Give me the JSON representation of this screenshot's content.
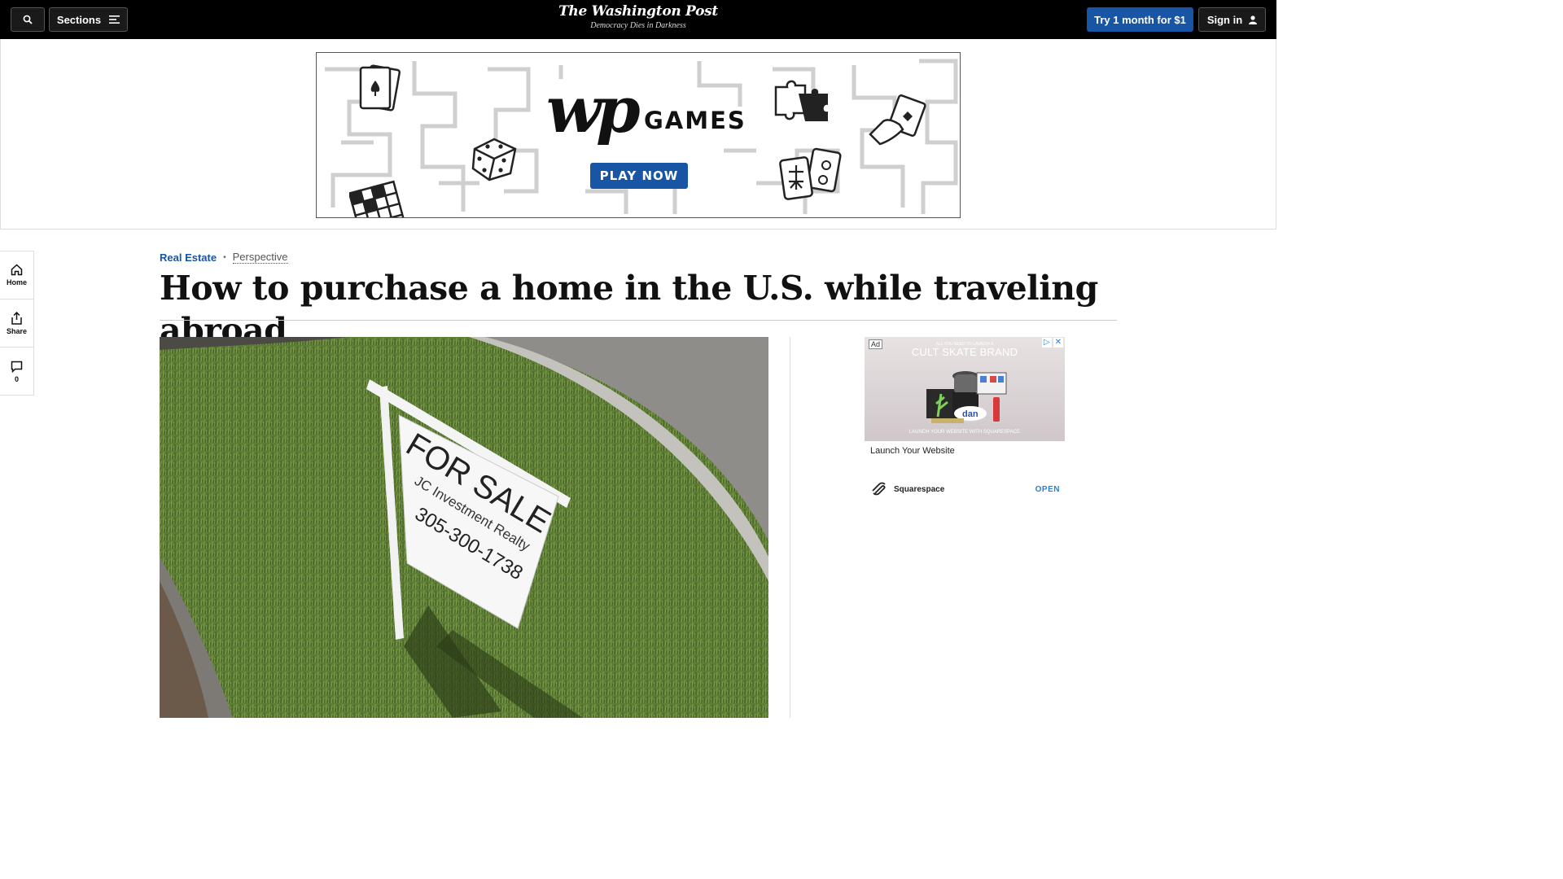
{
  "nav": {
    "sections_label": "Sections",
    "logo_name": "The Washington Post",
    "tagline": "Democracy Dies in Darkness",
    "subscribe_label": "Try 1 month for $1",
    "signin_label": "Sign in"
  },
  "games_ad": {
    "brand": "wp",
    "title": "GAMES",
    "cta": "PLAY NOW"
  },
  "rail": {
    "home_label": "Home",
    "share_label": "Share",
    "comments_count": "0"
  },
  "article": {
    "section": "Real Estate",
    "label": "Perspective",
    "headline": "How to purchase a home in the U.S. while traveling abroad",
    "sign_line1": "FOR SALE",
    "sign_line2": "JC Investment Realty",
    "sign_line3": "305-300-1738"
  },
  "side_ad": {
    "ad_label": "Ad",
    "top_small": "ALL YOU NEED TO LAUNCH A",
    "brand_line": "CULT SKATE BRAND",
    "bottom_small": "LAUNCH YOUR WEBSITE WITH  SQUARESPACE",
    "headline": "Launch Your Website",
    "sponsor": "Squarespace",
    "cta": "OPEN"
  },
  "colors": {
    "accent": "#1955a5",
    "nav_bg": "#000000",
    "link_blue": "#2a7fd6"
  }
}
